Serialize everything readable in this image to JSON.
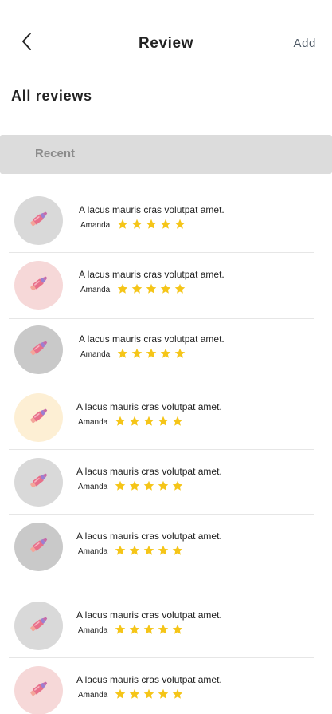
{
  "header": {
    "title": "Review",
    "add_label": "Add"
  },
  "section": {
    "title": "All reviews"
  },
  "tabs": {
    "recent_label": "Recent"
  },
  "colors": {
    "background": "#ffffff",
    "tab_bar": "#dcdcdc",
    "star": "#f5c518",
    "divider": "#e6e6e6"
  },
  "icons": {
    "back": "chevron-left-icon",
    "avatar": "lipstick-icon",
    "rating": "star-icon"
  },
  "reviews": [
    {
      "text": "A lacus mauris cras volutpat amet.",
      "author": "Amanda",
      "rating": 5,
      "avatar_bg": "#d9d9d9"
    },
    {
      "text": "A lacus mauris cras volutpat amet.",
      "author": "Amanda",
      "rating": 5,
      "avatar_bg": "#f6d8d8"
    },
    {
      "text": "A lacus mauris cras volutpat amet.",
      "author": "Amanda",
      "rating": 5,
      "avatar_bg": "#c9c9c9"
    },
    {
      "text": "A lacus mauris cras volutpat amet.",
      "author": "Amanda",
      "rating": 5,
      "avatar_bg": "#fdefd4"
    },
    {
      "text": "A lacus mauris cras volutpat amet.",
      "author": "Amanda",
      "rating": 5,
      "avatar_bg": "#d9d9d9"
    },
    {
      "text": "A lacus mauris cras volutpat amet.",
      "author": "Amanda",
      "rating": 5,
      "avatar_bg": "#c9c9c9"
    },
    {
      "text": "A lacus mauris cras volutpat amet.",
      "author": "Amanda",
      "rating": 5,
      "avatar_bg": "#d9d9d9"
    },
    {
      "text": "A lacus mauris cras volutpat amet.",
      "author": "Amanda",
      "rating": 5,
      "avatar_bg": "#f6d8d8"
    }
  ]
}
